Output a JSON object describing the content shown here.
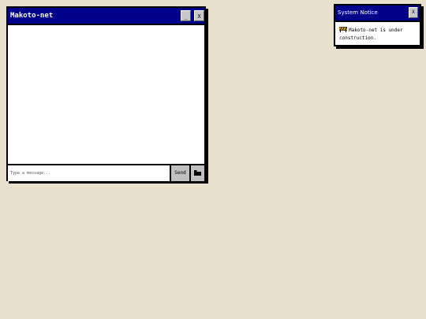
{
  "colors": {
    "desktop": "#e8dfcc",
    "titlebar": "#00008b",
    "border": "#000000",
    "button": "#c0c0c0"
  },
  "chat_window": {
    "title": "Makoto-net",
    "minimize_label": "_",
    "close_label": "X",
    "input": {
      "value": "",
      "placeholder": "Type a message..."
    },
    "send_label": "Send",
    "attach_icon": "folder-icon"
  },
  "notice_window": {
    "title": "System Notice",
    "close_label": "X",
    "icon": "construction-barrier-icon",
    "message": "Makoto-net is under construction."
  }
}
